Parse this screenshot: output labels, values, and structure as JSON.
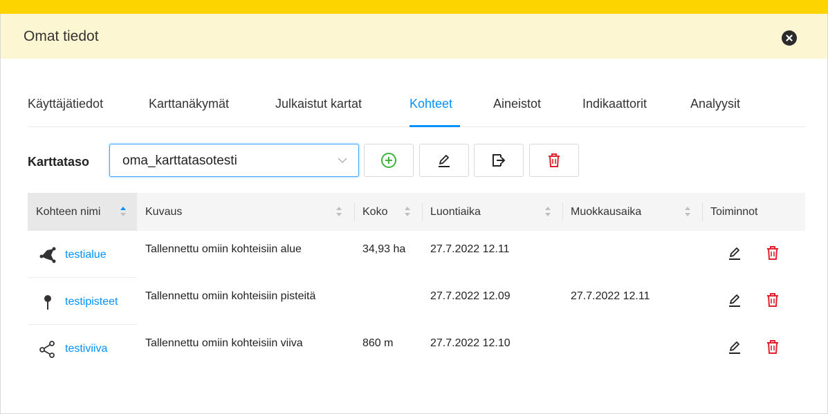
{
  "header": {
    "title": "Omat tiedot",
    "close_icon": "close-icon"
  },
  "tabs": [
    {
      "label": "Käyttäjätiedot",
      "active": false
    },
    {
      "label": "Karttanäkymät",
      "active": false
    },
    {
      "label": "Julkaistut kartat",
      "active": false
    },
    {
      "label": "Kohteet",
      "active": true
    },
    {
      "label": "Aineistot",
      "active": false
    },
    {
      "label": "Indikaattorit",
      "active": false
    },
    {
      "label": "Analyysit",
      "active": false
    }
  ],
  "toolbar": {
    "label": "Karttataso",
    "select_value": "oma_karttatasotesti",
    "buttons": [
      "add-icon",
      "edit-icon",
      "export-icon",
      "delete-icon"
    ]
  },
  "table": {
    "columns": [
      "Kohteen nimi",
      "Kuvaus",
      "Koko",
      "Luontiaika",
      "Muokkausaika",
      "Toiminnot"
    ],
    "rows": [
      {
        "icon": "area-icon",
        "name": "testialue",
        "kuvaus": "Tallennettu omiin kohteisiin alue",
        "koko": "34,93 ha",
        "luontiaika": "27.7.2022 12.11",
        "muokkausaika": ""
      },
      {
        "icon": "point-icon",
        "name": "testipisteet",
        "kuvaus": "Tallennettu omiin kohteisiin pisteitä",
        "koko": "",
        "luontiaika": "27.7.2022 12.09",
        "muokkausaika": "27.7.2022 12.11"
      },
      {
        "icon": "line-icon",
        "name": "testiviiva",
        "kuvaus": "Tallennettu omiin kohteisiin viiva",
        "koko": "860 m",
        "luontiaika": "27.7.2022 12.10",
        "muokkausaika": ""
      }
    ]
  },
  "colors": {
    "accent": "#0091ff",
    "header_bg": "#fdf6d3",
    "top_bar": "#fdd400",
    "delete": "#e0202a",
    "add": "#3db33d"
  }
}
